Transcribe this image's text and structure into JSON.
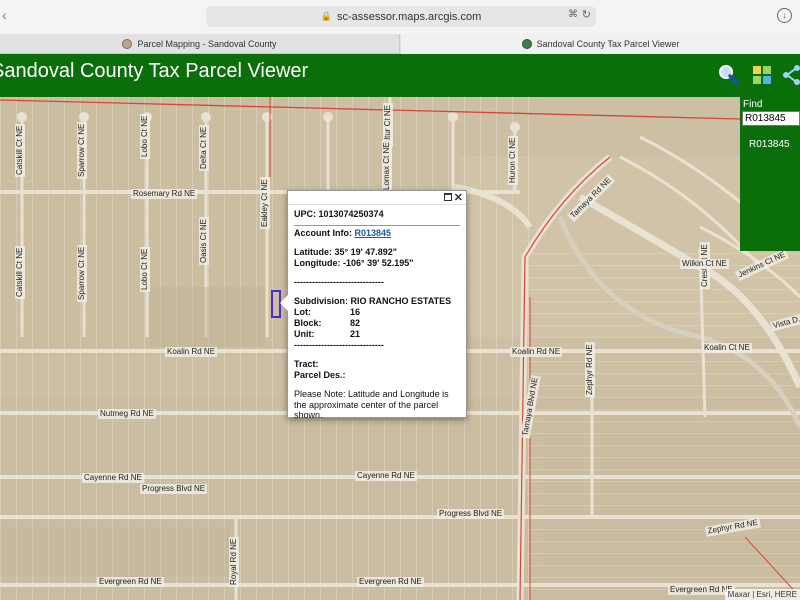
{
  "browser": {
    "url": "sc-assessor.maps.arcgis.com",
    "tabs": [
      {
        "label": "Parcel Mapping - Sandoval County"
      },
      {
        "label": "Sandoval County Tax Parcel Viewer"
      }
    ]
  },
  "header": {
    "title": "Sandoval County Tax Parcel Viewer",
    "icons": [
      "search-icon",
      "grid-icon",
      "share-icon"
    ],
    "color": "#0a6f0a"
  },
  "find": {
    "label": "Find",
    "value": "R013845",
    "result": "R013845"
  },
  "popup": {
    "upc": "UPC: 1013074250374",
    "account_label": "Account Info:",
    "account_value": "R013845",
    "latitude": "Latitude: 35° 19' 47.892\"",
    "longitude": "Longitude: -106° 39' 52.195\"",
    "separator": "------------------------------",
    "subdivision": "Subdivision: RIO RANCHO ESTATES",
    "lot_label": "Lot:",
    "lot_value": "16",
    "block_label": "Block:",
    "block_value": "82",
    "unit_label": "Unit:",
    "unit_value": "21",
    "tract": "Tract:",
    "parcel_des": "Parcel Des.:",
    "note": "Please Note: Latitude and Longitude is the approximate center of the parcel shown."
  },
  "map": {
    "attribution": "Maxar | Esri, HERE",
    "roads": {
      "rosemary": "Rosemary Rd NE",
      "koalin_w": "Koalin Rd NE",
      "koalin_e": "Koalin Rd NE",
      "koalin_ct": "Koalin Ct NE",
      "nutmeg": "Nutmeg Rd NE",
      "cayenne_w": "Cayenne Rd NE",
      "cayenne_e": "Cayenne Rd NE",
      "progress_w": "Progress Blvd NE",
      "progress_e": "Progress Blvd NE",
      "evergreen_w": "Evergreen Rd NE",
      "evergreen_m": "Evergreen Rd NE",
      "evergreen_e": "Evergreen Rd NE",
      "wilkin": "Wilkin Ct NE",
      "jenkins": "Jenkins Ct NE",
      "vista": "Vista D...",
      "tamaya": "Tamaya Rd NE",
      "tamaya_blvd": "Tamaya Blvd NE",
      "zephyr": "Zephyr Rd NE",
      "zephyr2": "Zephyr Rd NE",
      "crest": "Crest Ct NE",
      "catskill": "Catskill Ct NE",
      "sparrow": "Sparrow Ct NE",
      "lobo": "Lobo Ct NE",
      "oasis": "Oasis Ct NE",
      "delta": "Delta Ct NE",
      "eakley": "Eakley Ct NE",
      "lomax": "Lomax Ct NE",
      "altur": "Altur Ct NE",
      "huron": "Huron Ct NE",
      "royal": "Royal Rd NE"
    }
  }
}
